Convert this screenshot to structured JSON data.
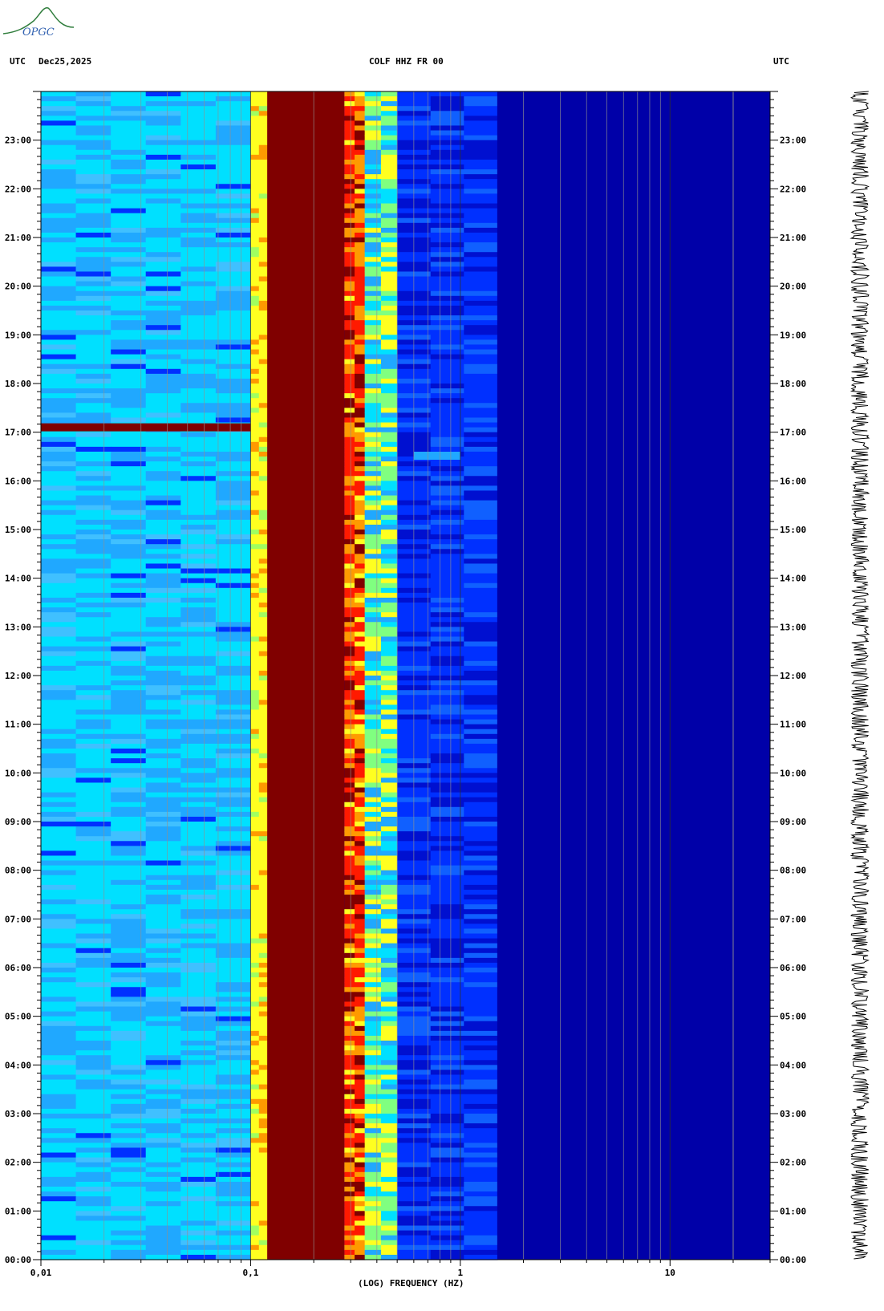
{
  "header": {
    "utc_left": "UTC",
    "date": "Dec25,2025",
    "station": "COLF HHZ FR 00",
    "utc_right": "UTC"
  },
  "logo": {
    "text": "OPGC",
    "color": "#2f7d3c"
  },
  "colors": {
    "dark_red": "#800000",
    "red": "#ff1a00",
    "orange": "#ff9a00",
    "yellow": "#ffff20",
    "cyan": "#00e0ff",
    "light_blue": "#20a8ff",
    "blue": "#0030ff",
    "navy": "#0000a8"
  },
  "chart_data": {
    "type": "heatmap",
    "title": "COLF HHZ FR 00",
    "xlabel": "(LOG) FREQUENCY (HZ)",
    "ylabel": "UTC",
    "x_scale": "log",
    "xlim": [
      0.01,
      30
    ],
    "x_ticks": [
      {
        "value": 0.01,
        "label": "0,01"
      },
      {
        "value": 0.1,
        "label": "0,1"
      },
      {
        "value": 1,
        "label": "1"
      },
      {
        "value": 10,
        "label": "10"
      }
    ],
    "y_ticks": [
      "00:00",
      "01:00",
      "02:00",
      "03:00",
      "04:00",
      "05:00",
      "06:00",
      "07:00",
      "08:00",
      "09:00",
      "10:00",
      "11:00",
      "12:00",
      "13:00",
      "14:00",
      "15:00",
      "16:00",
      "17:00",
      "18:00",
      "19:00",
      "20:00",
      "21:00",
      "22:00",
      "23:00"
    ],
    "ylim_hours": [
      0,
      24
    ],
    "frequency_bands": [
      {
        "f_start": 0.01,
        "f_end": 0.1,
        "level": "cyan-light-blue"
      },
      {
        "f_start": 0.1,
        "f_end": 0.12,
        "level": "yellow"
      },
      {
        "f_start": 0.12,
        "f_end": 0.28,
        "level": "dark-red"
      },
      {
        "f_start": 0.28,
        "f_end": 0.35,
        "level": "red-orange"
      },
      {
        "f_start": 0.35,
        "f_end": 0.5,
        "level": "yellow-cyan"
      },
      {
        "f_start": 0.5,
        "f_end": 1.5,
        "level": "blue"
      },
      {
        "f_start": 1.5,
        "f_end": 30,
        "level": "navy"
      }
    ],
    "events": [
      {
        "time": "17:05",
        "f_start": 0.01,
        "f_end": 0.1,
        "level": "dark-red"
      },
      {
        "time": "16:30",
        "f_start": 0.6,
        "f_end": 1.0,
        "level": "light-blue"
      }
    ],
    "grid": true
  }
}
